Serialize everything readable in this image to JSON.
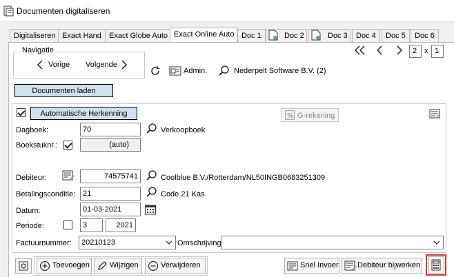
{
  "window": {
    "title": "Documenten digitaliseren"
  },
  "tabs": [
    {
      "label": "Digitaliseren"
    },
    {
      "label": "Exact Hand"
    },
    {
      "label": "Exact Globe Auto"
    },
    {
      "label": "Exact Online Auto",
      "active": true
    },
    {
      "label": "Doc 1"
    },
    {
      "label": "Doc 2"
    },
    {
      "label": "Doc 3"
    },
    {
      "label": "Doc 4"
    },
    {
      "label": "Doc 5"
    },
    {
      "label": "Doc 6"
    }
  ],
  "navigation": {
    "group_label": "Navigatie",
    "prev_label": "Vorige",
    "next_label": "Volgende",
    "admin_label": "Admin.",
    "company": "Nederpelt Software B.V. (2)",
    "page_current": "2",
    "page_sep": "x",
    "page_total": "1"
  },
  "load_button": "Documenten laden",
  "auto_recognition": {
    "label": "Automatische Herkenning",
    "checked": true
  },
  "g_account_button": "G-rekening",
  "form": {
    "dagboek_label": "Dagboek:",
    "dagboek_value": "70",
    "dagboek_desc": "Verkoopboek",
    "boekstuk_label": "Boekstuknr.:",
    "boekstuk_value": "(auto)",
    "debiteur_label": "Debiteur:",
    "debiteur_value": "74575741",
    "debiteur_desc": "Coolblue B.V./Rotterdam/NL50INGB0683251309",
    "betaling_label": "Betalingsconditie:",
    "betaling_value": "21",
    "betaling_desc": "Code 21 Kas",
    "datum_label": "Datum:",
    "datum_value": "01-03-2021",
    "periode_label": "Periode:",
    "periode_value": "3",
    "periode_year": "2021",
    "factuur_label": "Factuurnummer:",
    "factuur_value": "20210123",
    "omschrijving_label": "Omschrijving:",
    "omschrijving_value": ""
  },
  "toolbar": {
    "add": "Toevoegen",
    "edit": "Wijzigen",
    "delete": "Verwijderen",
    "quick_entry": "Snel Invoer",
    "update_debtor": "Debiteur bijwerken"
  },
  "colors": {
    "highlight_border": "#e0312f",
    "accent_button": "#cfe1ee"
  }
}
